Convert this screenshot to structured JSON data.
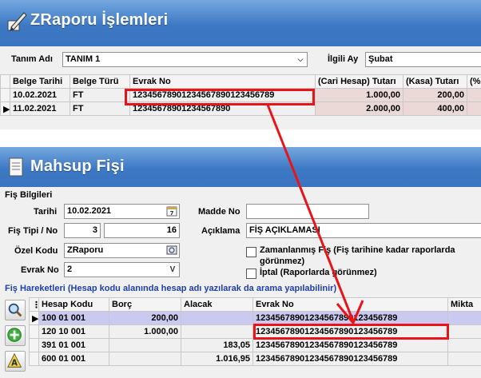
{
  "zraporu": {
    "title": "ZRaporu İşlemleri",
    "tanim_label": "Tanım Adı",
    "tanim_value": "TANIM 1",
    "ay_label": "İlgili Ay",
    "ay_value": "Şubat",
    "columns": [
      "Belge Tarihi",
      "Belge Türü",
      "Evrak No",
      "(Cari Hesap) Tutarı",
      "(Kasa) Tutarı",
      "(%"
    ],
    "rows": [
      {
        "tarih": "10.02.2021",
        "tur": "FT",
        "evrak": "12345678901234567890123456789",
        "cari": "1.000,00",
        "kasa": "200,00"
      },
      {
        "tarih": "11.02.2021",
        "tur": "FT",
        "evrak": "12345678901234567890",
        "cari": "2.000,00",
        "kasa": "400,00"
      }
    ]
  },
  "mahsup": {
    "title": "Mahsup Fişi",
    "fis_bilgileri": "Fiş Bilgileri",
    "tarih_label": "Tarihi",
    "tarih_value": "10.02.2021",
    "fis_tipi_label": "Fiş Tipi / No",
    "fis_tipi_value": "3",
    "fis_no_value": "16",
    "ozel_kod_label": "Özel Kodu",
    "ozel_kod_value": "ZRaporu",
    "evrak_no_label": "Evrak No",
    "evrak_no_value": "2",
    "madde_no_label": "Madde No",
    "madde_no_value": "",
    "aciklama_label": "Açıklama",
    "aciklama_value": "FİŞ AÇIKLAMASI",
    "zamanlanmis_line1": "Zamanlanmış Fiş (Fiş tarihine kadar raporlarda",
    "zamanlanmis_line2": "görünmez)",
    "iptal_label": "İptal (Raporlarda görünmez)",
    "hareketler_label": "Fiş Hareketleri (Hesap kodu alanında hesap adı yazılarak da arama yapılabilinir)",
    "columns": [
      "Hesap Kodu",
      "Borç",
      "Alacak",
      "Evrak No",
      "Mikta"
    ],
    "rows": [
      {
        "hesap": "100 01 001",
        "borc": "200,00",
        "alacak": "",
        "evrak": "12345678901234567890123456789"
      },
      {
        "hesap": "120 10 001",
        "borc": "1.000,00",
        "alacak": "",
        "evrak": "12345678901234567890123456789"
      },
      {
        "hesap": "391 01 001",
        "borc": "",
        "alacak": "183,05",
        "evrak": "12345678901234567890123456789"
      },
      {
        "hesap": "600 01 001",
        "borc": "",
        "alacak": "1.016,95",
        "evrak": "12345678901234567890123456789"
      }
    ]
  },
  "colors": {
    "highlight": "#e8141a",
    "title_bar": "#3d78c4",
    "selected_row": "#cbc9f0"
  }
}
